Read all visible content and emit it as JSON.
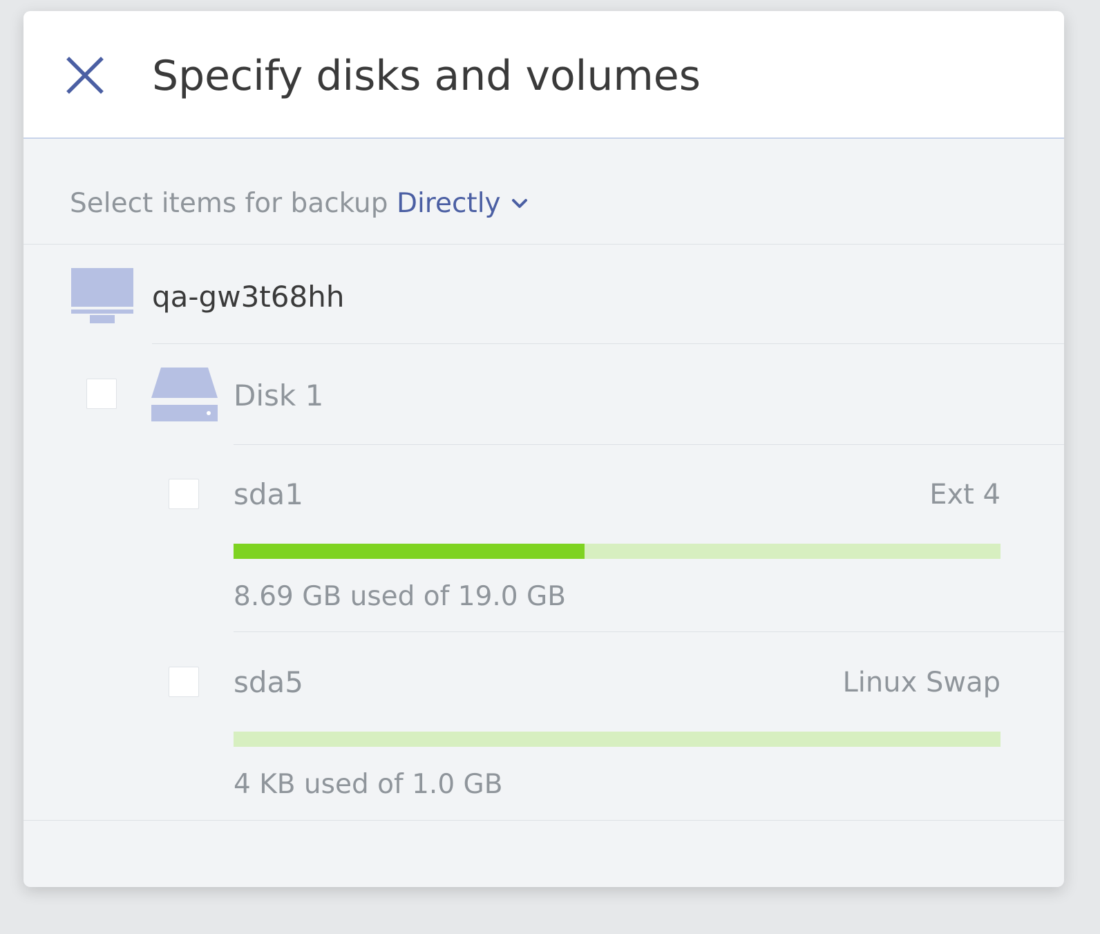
{
  "dialog": {
    "title": "Specify disks and volumes",
    "close_icon": "close-icon"
  },
  "selector": {
    "label": "Select items for backup",
    "value": "Directly",
    "icon": "chevron-down-icon"
  },
  "machine": {
    "name": "qa-gw3t68hh",
    "icon": "monitor-icon"
  },
  "disk": {
    "label": "Disk 1",
    "icon": "hard-drive-icon",
    "volumes": [
      {
        "name": "sda1",
        "filesystem": "Ext 4",
        "usage_text": "8.69 GB used of 19.0 GB",
        "used_fraction": 0.4574
      },
      {
        "name": "sda5",
        "filesystem": "Linux Swap",
        "usage_text": "4 KB used of 1.0 GB",
        "used_fraction": 4e-06
      }
    ]
  },
  "colors": {
    "accent": "#4b5fa3",
    "bar_used": "#7ed321",
    "bar_free": "#d7efc0",
    "icon_fill": "#b6c0e3"
  }
}
